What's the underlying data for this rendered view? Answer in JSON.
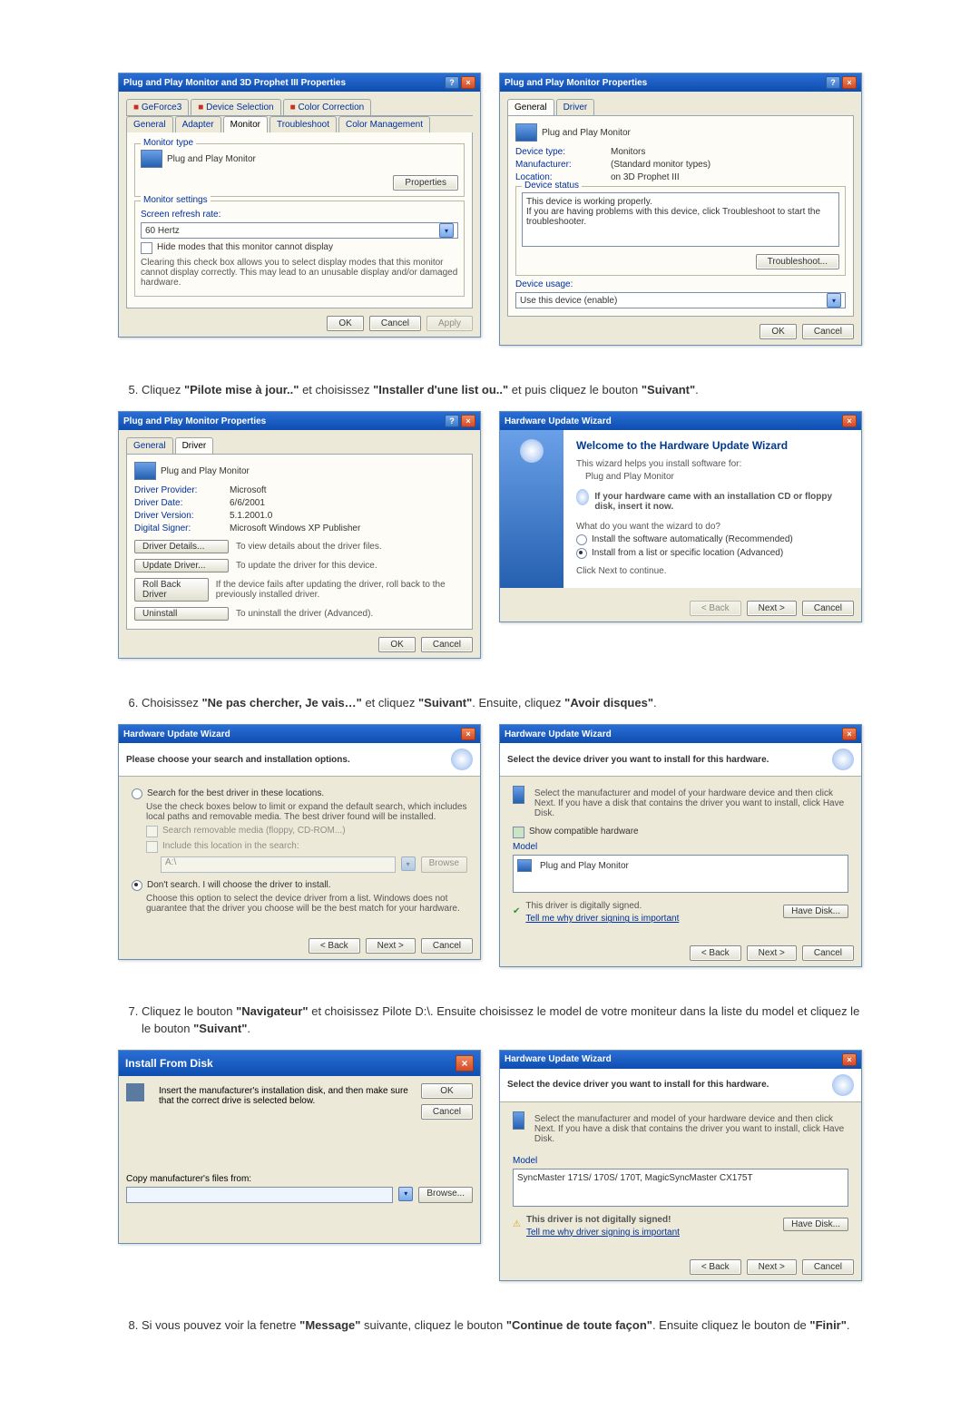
{
  "step5": {
    "num": "5.",
    "t1": "Cliquez ",
    "b1": "\"Pilote mise à jour..\"",
    "t2": " et choisissez ",
    "b2": "\"Installer d'une list ou..\"",
    "t3": " et puis cliquez le bouton ",
    "b3": "\"Suivant\"",
    "t4": "."
  },
  "step6": {
    "num": "6.",
    "t1": "Choisissez ",
    "b1": "\"Ne pas chercher, Je vais…\"",
    "t2": " et cliquez ",
    "b2": "\"Suivant\"",
    "t3": ". Ensuite, cliquez ",
    "b3": "\"Avoir disques\"",
    "t4": "."
  },
  "step7": {
    "num": "7.",
    "t1": "Cliquez le bouton ",
    "b1": "\"Navigateur\"",
    "t2": " et choisissez Pilote D:\\. Ensuite choisissez le model de votre moniteur dans la liste du model et cliquez le le bouton ",
    "b2": "\"Suivant\"",
    "t3": "."
  },
  "step8": {
    "num": "8.",
    "t1": "Si vous pouvez voir la fenetre ",
    "b1": "\"Message\"",
    "t2": " suivante, cliquez le bouton ",
    "b2": "\"Continue de toute façon\"",
    "t3": ". Ensuite cliquez le bouton de ",
    "b3": "\"Finir\"",
    "t4": "."
  },
  "dlgA": {
    "title": "Plug and Play Monitor and 3D Prophet III Properties",
    "tabs": {
      "geforce": "GeForce3",
      "device_sel": "Device Selection",
      "color_corr": "Color Correction",
      "general": "General",
      "adapter": "Adapter",
      "monitor": "Monitor",
      "troubleshoot": "Troubleshoot",
      "color_mgmt": "Color Management"
    },
    "monitor_type": "Monitor type",
    "monitor_name": "Plug and Play Monitor",
    "properties_btn": "Properties",
    "monitor_settings": "Monitor settings",
    "refresh_label": "Screen refresh rate:",
    "refresh_value": "60 Hertz",
    "hide_modes": "Hide modes that this monitor cannot display",
    "hide_desc": "Clearing this check box allows you to select display modes that this monitor cannot display correctly. This may lead to an unusable display and/or damaged hardware.",
    "ok": "OK",
    "cancel": "Cancel",
    "apply": "Apply"
  },
  "dlgB": {
    "title": "Plug and Play Monitor Properties",
    "tab_general": "General",
    "tab_driver": "Driver",
    "pnp": "Plug and Play Monitor",
    "dev_type_l": "Device type:",
    "dev_type_v": "Monitors",
    "manu_l": "Manufacturer:",
    "manu_v": "(Standard monitor types)",
    "loc_l": "Location:",
    "loc_v": "on 3D Prophet III",
    "dev_status": "Device status",
    "dev_ok": "This device is working properly.",
    "dev_help": "If you are having problems with this device, click Troubleshoot to start the troubleshooter.",
    "troubleshoot_btn": "Troubleshoot...",
    "dev_usage": "Device usage:",
    "dev_usage_v": "Use this device (enable)",
    "ok": "OK",
    "cancel": "Cancel"
  },
  "dlgC": {
    "title": "Plug and Play Monitor Properties",
    "tab_general": "General",
    "tab_driver": "Driver",
    "pnp": "Plug and Play Monitor",
    "prov_l": "Driver Provider:",
    "prov_v": "Microsoft",
    "date_l": "Driver Date:",
    "date_v": "6/6/2001",
    "ver_l": "Driver Version:",
    "ver_v": "5.1.2001.0",
    "sig_l": "Digital Signer:",
    "sig_v": "Microsoft Windows XP Publisher",
    "b1": "Driver Details...",
    "b1d": "To view details about the driver files.",
    "b2": "Update Driver...",
    "b2d": "To update the driver for this device.",
    "b3": "Roll Back Driver",
    "b3d": "If the device fails after updating the driver, roll back to the previously installed driver.",
    "b4": "Uninstall",
    "b4d": "To uninstall the driver (Advanced).",
    "ok": "OK",
    "cancel": "Cancel"
  },
  "dlgD": {
    "title": "Hardware Update Wizard",
    "welcome": "Welcome to the Hardware Update Wizard",
    "intro": "This wizard helps you install software for:",
    "device": "Plug and Play Monitor",
    "cd_hint": "If your hardware came with an installation CD or floppy disk, insert it now.",
    "q": "What do you want the wizard to do?",
    "r1": "Install the software automatically (Recommended)",
    "r2": "Install from a list or specific location (Advanced)",
    "cont": "Click Next to continue.",
    "back": "< Back",
    "next": "Next >",
    "cancel": "Cancel"
  },
  "dlgE": {
    "title": "Hardware Update Wizard",
    "head": "Please choose your search and installation options.",
    "r1": "Search for the best driver in these locations.",
    "r1d": "Use the check boxes below to limit or expand the default search, which includes local paths and removable media. The best driver found will be installed.",
    "c1": "Search removable media (floppy, CD-ROM...)",
    "c2": "Include this location in the search:",
    "path": "A:\\",
    "browse": "Browse",
    "r2": "Don't search. I will choose the driver to install.",
    "r2d": "Choose this option to select the device driver from a list. Windows does not guarantee that the driver you choose will be the best match for your hardware.",
    "back": "< Back",
    "next": "Next >",
    "cancel": "Cancel"
  },
  "dlgF": {
    "title": "Hardware Update Wizard",
    "head": "Select the device driver you want to install for this hardware.",
    "hint": "Select the manufacturer and model of your hardware device and then click Next. If you have a disk that contains the driver you want to install, click Have Disk.",
    "show_compat": "Show compatible hardware",
    "model_l": "Model",
    "model_v": "Plug and Play Monitor",
    "signed": "This driver is digitally signed.",
    "tell": "Tell me why driver signing is important",
    "have_disk": "Have Disk...",
    "back": "< Back",
    "next": "Next >",
    "cancel": "Cancel"
  },
  "dlgG": {
    "title": "Install From Disk",
    "msg": "Insert the manufacturer's installation disk, and then make sure that the correct drive is selected below.",
    "ok": "OK",
    "cancel": "Cancel",
    "copy_l": "Copy manufacturer's files from:",
    "path": "",
    "browse": "Browse..."
  },
  "dlgH": {
    "title": "Hardware Update Wizard",
    "head": "Select the device driver you want to install for this hardware.",
    "hint": "Select the manufacturer and model of your hardware device and then click Next. If you have a disk that contains the driver you want to install, click Have Disk.",
    "model_l": "Model",
    "model_v": "SyncMaster 171S/ 170S/ 170T, MagicSyncMaster CX175T",
    "warn": "This driver is not digitally signed!",
    "tell": "Tell me why driver signing is important",
    "have_disk": "Have Disk...",
    "back": "< Back",
    "next": "Next >",
    "cancel": "Cancel"
  }
}
